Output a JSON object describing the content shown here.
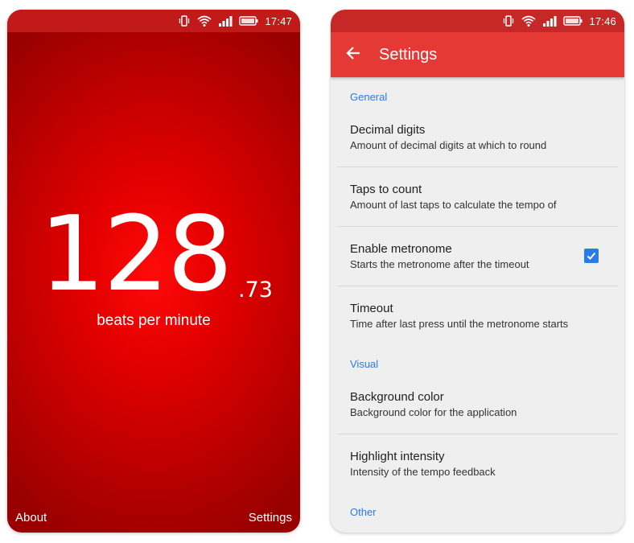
{
  "left_screen": {
    "status_time": "17:47",
    "bpm_integer": "128",
    "bpm_decimal": ".73",
    "bpm_unit": "beats per minute",
    "about_label": "About",
    "settings_label": "Settings"
  },
  "right_screen": {
    "status_time": "17:46",
    "title": "Settings",
    "sections": {
      "general": "General",
      "visual": "Visual",
      "other": "Other"
    },
    "items": {
      "decimal_digits": {
        "title": "Decimal digits",
        "summary": "Amount of decimal digits at which to round"
      },
      "taps_to_count": {
        "title": "Taps to count",
        "summary": "Amount of last taps to calculate the tempo of"
      },
      "enable_metronome": {
        "title": "Enable metronome",
        "summary": "Starts the metronome after the timeout",
        "checked": true
      },
      "timeout": {
        "title": "Timeout",
        "summary": "Time after last press until the metronome starts"
      },
      "background_color": {
        "title": "Background color",
        "summary": "Background color for the application"
      },
      "highlight_intensity": {
        "title": "Highlight intensity",
        "summary": "Intensity of the tempo feedback"
      }
    }
  },
  "icons": [
    "vibrate-icon",
    "wifi-icon",
    "signal-icon",
    "battery-icon",
    "back-arrow-icon",
    "check-icon"
  ],
  "colors": {
    "app_red": "#e53935",
    "status_red": "#c62828",
    "accent_blue": "#2a7be6",
    "settings_bg": "#efefef"
  }
}
